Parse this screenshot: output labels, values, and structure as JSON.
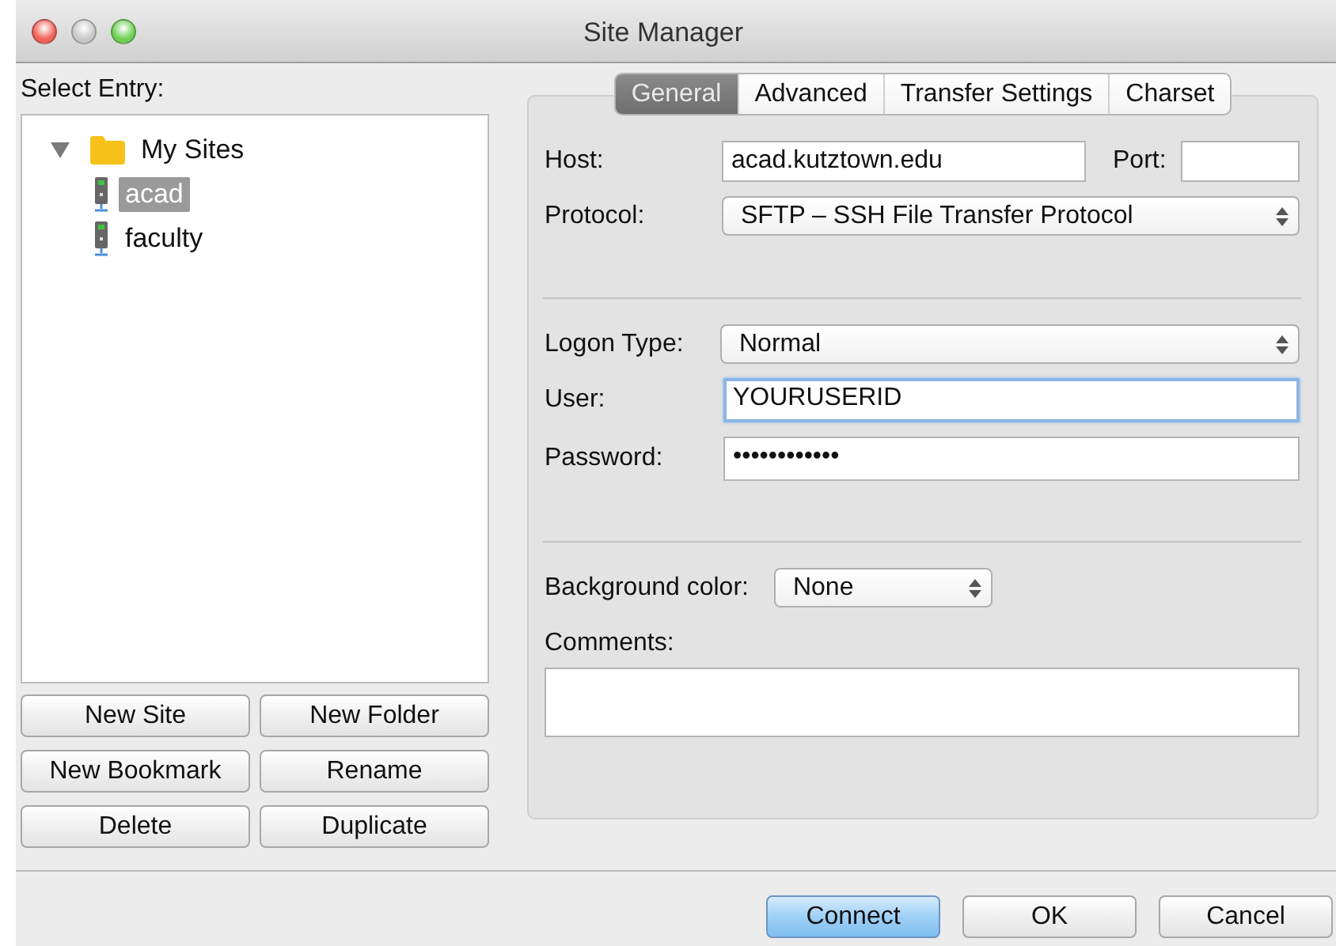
{
  "window": {
    "title": "Site Manager"
  },
  "select_entry_label": "Select Entry:",
  "tree": [
    {
      "label": "My Sites",
      "kind": "folder",
      "expanded": true,
      "selected": false,
      "children": [
        {
          "label": "acad",
          "kind": "site",
          "selected": true
        },
        {
          "label": "faculty",
          "kind": "site",
          "selected": false
        }
      ]
    }
  ],
  "entry_buttons": [
    "New Site",
    "New Folder",
    "New Bookmark",
    "Rename",
    "Delete",
    "Duplicate"
  ],
  "tabs": [
    {
      "label": "General",
      "selected": true
    },
    {
      "label": "Advanced",
      "selected": false
    },
    {
      "label": "Transfer Settings",
      "selected": false
    },
    {
      "label": "Charset",
      "selected": false
    }
  ],
  "host": {
    "label": "Host:",
    "value": "acad.kutztown.edu"
  },
  "port": {
    "label": "Port:"
  },
  "protocol": {
    "label": "Protocol:",
    "value": "SFTP – SSH File Transfer Protocol"
  },
  "logon_type": {
    "label": "Logon Type:",
    "value": "Normal"
  },
  "user": {
    "label": "User:",
    "value": "YOURUSERID",
    "focused": true
  },
  "password": {
    "label": "Password:",
    "value": "••••••••••••",
    "focused": false
  },
  "background_color": {
    "label": "Background color:",
    "value": "None"
  },
  "comments": {
    "label": "Comments:"
  },
  "dialog_buttons": [
    {
      "label": "Connect",
      "default": true
    },
    {
      "label": "OK",
      "default": false
    },
    {
      "label": "Cancel",
      "default": false
    }
  ]
}
